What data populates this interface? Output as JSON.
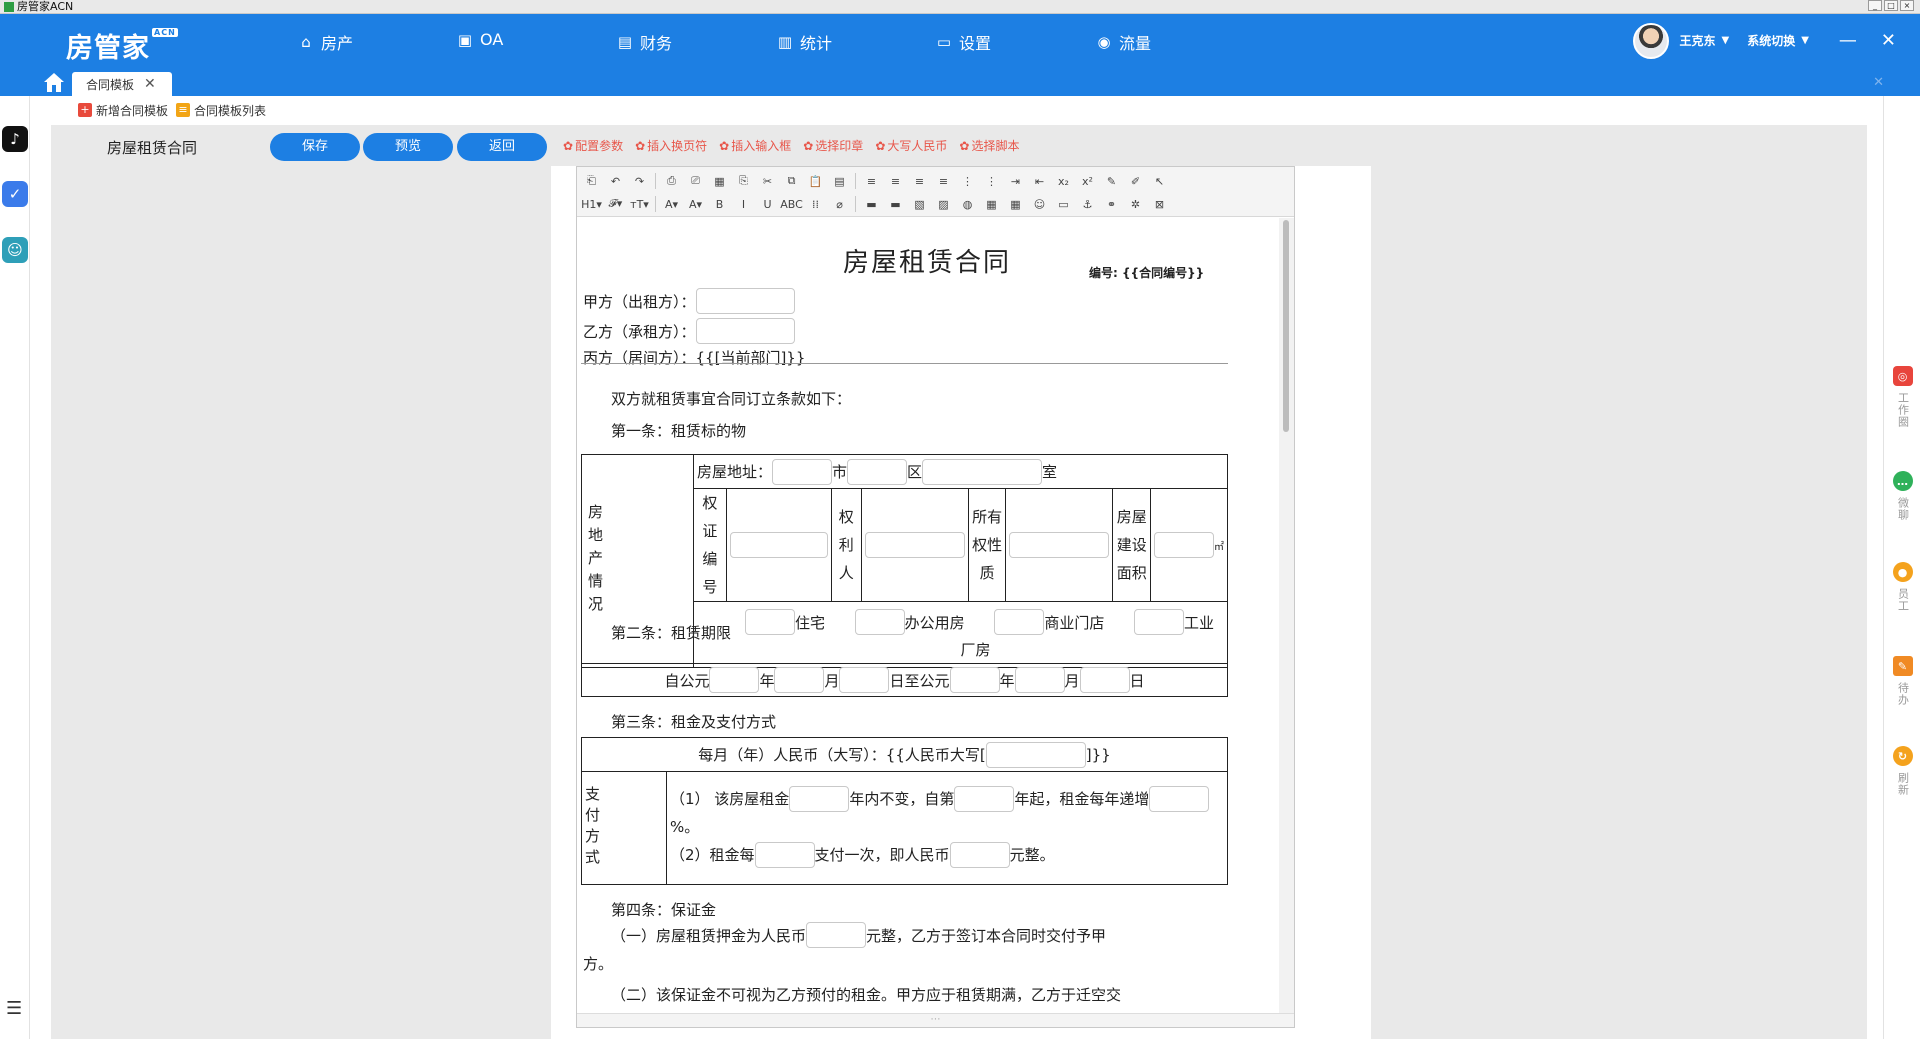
{
  "window": {
    "title": "房管家ACN",
    "controls": [
      "_",
      "□",
      "×"
    ]
  },
  "brand": {
    "name": "房管家",
    "badge": "ACN"
  },
  "nav": [
    {
      "icon": "home-icon",
      "glyph": "⌂",
      "label": "房产"
    },
    {
      "icon": "briefcase-icon",
      "glyph": "▣",
      "label": "OA"
    },
    {
      "icon": "wallet-icon",
      "glyph": "▤",
      "label": "财务"
    },
    {
      "icon": "bar-chart-icon",
      "glyph": "▥",
      "label": "统计"
    },
    {
      "icon": "monitor-icon",
      "glyph": "▭",
      "label": "设置"
    },
    {
      "icon": "flow-icon",
      "glyph": "◉",
      "label": "流量"
    }
  ],
  "user": {
    "name": "王克东",
    "switch": "系统切换",
    "minimize": "—",
    "close": "✕"
  },
  "tabs": [
    {
      "label": "合同模板",
      "close": "✕"
    }
  ],
  "tab_close_all": "✕",
  "subbar": {
    "add_label": "新增合同模板",
    "list_label": "合同模板列表"
  },
  "actionbar": {
    "doc_title": "房屋租赁合同",
    "save": "保存",
    "preview": "预览",
    "back": "返回",
    "tools": [
      "配置参数",
      "插入换页符",
      "插入输入框",
      "选择印章",
      "大写人民币",
      "选择脚本"
    ]
  },
  "editor_toolbar": {
    "row1": [
      "⎗",
      "↶",
      "↷",
      "|",
      "⎙",
      "⎚",
      "▦",
      "⎘",
      "✂",
      "⧉",
      "📋",
      "▤",
      "|",
      "≡",
      "≡",
      "≡",
      "≡",
      "⋮",
      "⋮",
      "⇥",
      "⇤",
      "x₂",
      "x²",
      "✎",
      "✐",
      "↖"
    ],
    "row2": [
      "H1▾",
      "𝓕▾",
      "тT▾",
      "|",
      "A▾",
      "A▾",
      "B",
      "I",
      "U",
      "ABC",
      "⁞⁞",
      "⌀",
      "|",
      "▬",
      "▬",
      "▧",
      "▨",
      "◍",
      "▦",
      "▦",
      "☺",
      "▭",
      "⚓",
      "⚭",
      "✲",
      "⊠"
    ]
  },
  "doc": {
    "title": "房屋租赁合同",
    "number_label": "编号: {{合同编号}}",
    "party_a": "甲方（出租方）：",
    "party_b": "乙方（承租方）：",
    "party_c": "丙方（居间方）：{{[当前部门]}}",
    "intro": "双方就租赁事宜合同订立条款如下：",
    "art1": "第一条：租赁标的物",
    "t1": {
      "side": "房地产情况",
      "addr_label": "房屋地址：",
      "city": "市",
      "district": "区",
      "room": "室",
      "cert_label": "权证编号",
      "owner_label": "权利人",
      "prop_label": "所有权性质",
      "area_label": "房屋建设面积",
      "area_unit": "㎡",
      "types": [
        "住宅",
        "办公用房",
        "商业门店",
        "工业"
      ],
      "type_extra": "厂房"
    },
    "art2": "第二条：租赁期限",
    "t2": {
      "from": "自公元",
      "year": "年",
      "month": "月",
      "day_to": "日至公元",
      "day": "日"
    },
    "art3": "第三条：租金及支付方式",
    "t3": {
      "monthly": "每月（年）人民币（大写）：{{人民币大写[",
      "monthly_end": "]}}",
      "side": "支付方式",
      "p1_a": "（1） 该房屋租金",
      "p1_b": "年内不变，自第",
      "p1_c": "年起，租金每年递增",
      "p1_d": "%。",
      "p2_a": "（2）租金每",
      "p2_b": "支付一次，即人民币",
      "p2_c": "元整。"
    },
    "art4": "第四条：保证金",
    "dep1_a": "（一）房屋租赁押金为人民币",
    "dep1_b": "元整，乙方于签订本合同时交付予甲",
    "dep1_c": "方。",
    "dep2": "（二）该保证金不可视为乙方预付的租金。甲方应于租赁期满，乙方于迁空交"
  },
  "right_dock": [
    {
      "icon": "work-circle-icon",
      "label": "工作圈",
      "color": "#e8453c"
    },
    {
      "icon": "chat-icon",
      "label": "微聊",
      "color": "#2fb15a"
    },
    {
      "icon": "staff-icon",
      "label": "员工",
      "color": "#f4a21d"
    },
    {
      "icon": "todo-icon",
      "label": "待办",
      "color": "#f08a24"
    },
    {
      "icon": "refresh-icon",
      "label": "刷新",
      "color": "#f4a21d"
    }
  ],
  "colors": {
    "primary": "#1d7fe3",
    "link_red": "#e8564a",
    "workspace": "#e9e9e9"
  }
}
